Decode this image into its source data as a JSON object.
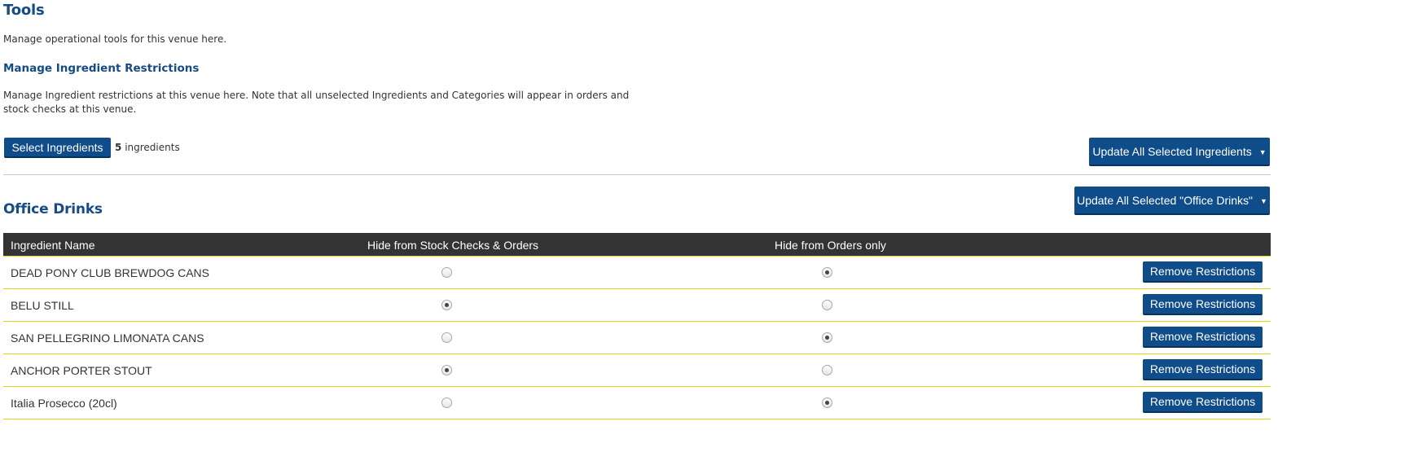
{
  "page": {
    "title": "Tools",
    "description": "Manage operational tools for this venue here."
  },
  "restrictions": {
    "title": "Manage Ingredient Restrictions",
    "description": "Manage Ingredient restrictions at this venue here. Note that all unselected Ingredients and Categories will appear in orders and stock checks at this venue.",
    "select_button": "Select Ingredients",
    "count_number": "5",
    "count_suffix": "ingredients",
    "update_all_button": "Update All Selected Ingredients"
  },
  "category": {
    "title": "Office Drinks",
    "update_button": "Update All Selected \"Office Drinks\"",
    "columns": [
      "Ingredient Name",
      "Hide from Stock Checks & Orders",
      "Hide from Orders only",
      ""
    ],
    "remove_label": "Remove Restrictions",
    "rows": [
      {
        "name": "DEAD PONY CLUB BREWDOG CANS",
        "hide_stock_and_orders": false,
        "hide_orders_only": true
      },
      {
        "name": "BELU STILL",
        "hide_stock_and_orders": true,
        "hide_orders_only": false
      },
      {
        "name": "SAN PELLEGRINO LIMONATA CANS",
        "hide_stock_and_orders": false,
        "hide_orders_only": true
      },
      {
        "name": "ANCHOR PORTER STOUT",
        "hide_stock_and_orders": true,
        "hide_orders_only": false
      },
      {
        "name": "Italia Prosecco (20cl)",
        "hide_stock_and_orders": false,
        "hide_orders_only": true
      }
    ]
  },
  "colors": {
    "heading": "#164b85",
    "button": "#0f4c8a",
    "table_header": "#333333",
    "row_border": "#e2d31a"
  },
  "icons": {
    "dropdown": "caret-down-icon"
  }
}
